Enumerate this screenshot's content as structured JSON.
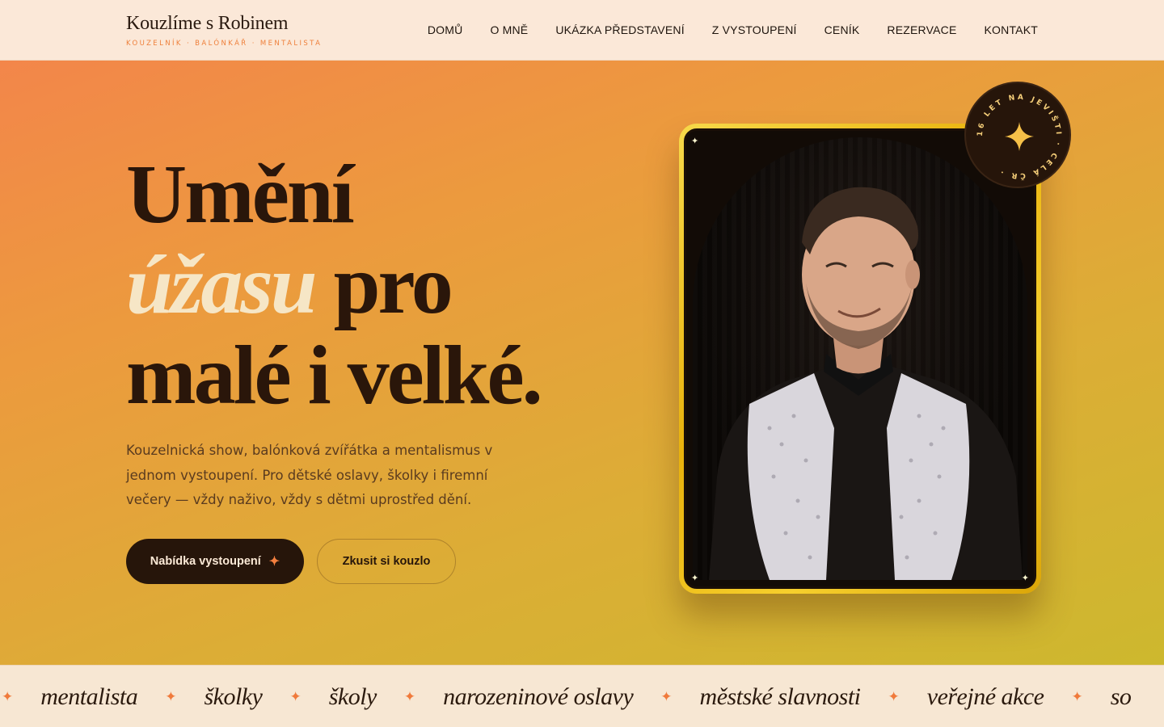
{
  "brand": {
    "title": "Kouzlíme s Robinem",
    "subtitle": "KOUZELNÍK · BALÓNKÁŘ · MENTALISTA"
  },
  "nav": {
    "items": [
      "DOMŮ",
      "O MNĚ",
      "UKÁZKA PŘEDSTAVENÍ",
      "Z VYSTOUPENÍ",
      "CENÍK",
      "REZERVACE",
      "KONTAKT"
    ]
  },
  "hero": {
    "line1": "Umění",
    "line2_accent": "úžasu",
    "line2_rest": " pro",
    "line3": "malé i velké.",
    "lead": "Kouzelnická show, balónková zvířátka a mentalismus v jednom vystoupení. Pro dětské oslavy, školky i firemní večery — vždy naživo, vždy s dětmi uprostřed dění.",
    "primary_button": "Nabídka vystoupení",
    "secondary_button": "Zkusit si kouzlo"
  },
  "badge": {
    "text": "16 LET NA JEVIŠTI · CELÁ ČR ·"
  },
  "marquee": {
    "items": [
      "mentalista",
      "školky",
      "školy",
      "narozeninové oslavy",
      "městské slavnosti",
      "veřejné akce",
      "so"
    ]
  },
  "colors": {
    "accent": "#f07a3b",
    "dark": "#26150a",
    "cream": "#f6e6c6",
    "gold": "#f6cf2d"
  },
  "icons": {
    "spark": "four-point-star-icon"
  }
}
